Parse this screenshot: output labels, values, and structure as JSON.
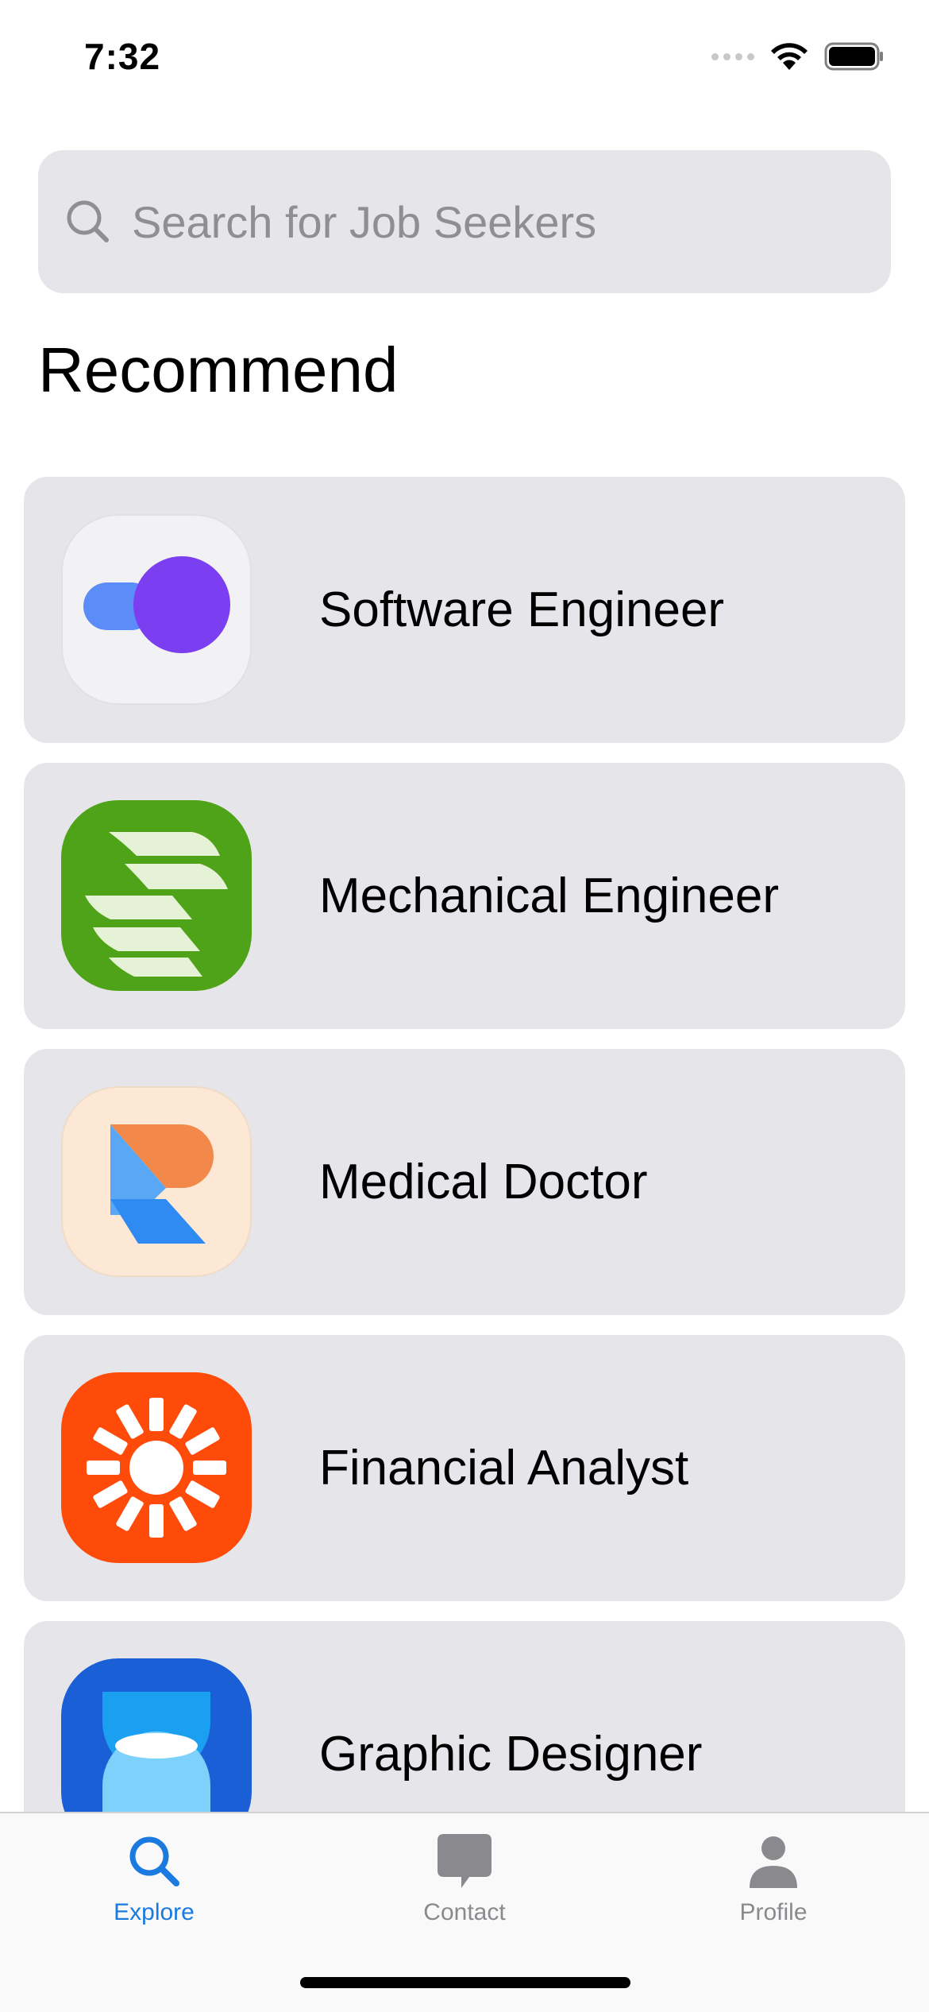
{
  "status_bar": {
    "time": "7:32"
  },
  "search": {
    "placeholder": "Search for Job Seekers",
    "value": ""
  },
  "section": {
    "title": "Recommend"
  },
  "jobs": [
    {
      "label": "Software Engineer",
      "icon": "overlapping-circles-icon"
    },
    {
      "label": "Mechanical Engineer",
      "icon": "striped-leaf-icon"
    },
    {
      "label": "Medical Doctor",
      "icon": "letter-r-shapes-icon"
    },
    {
      "label": "Financial Analyst",
      "icon": "sunburst-icon"
    },
    {
      "label": "Graphic Designer",
      "icon": "hourglass-icon"
    }
  ],
  "tabs": [
    {
      "label": "Explore",
      "icon": "search-icon",
      "active": true
    },
    {
      "label": "Contact",
      "icon": "chat-bubble-icon",
      "active": false
    },
    {
      "label": "Profile",
      "icon": "person-icon",
      "active": false
    }
  ],
  "colors": {
    "accent": "#1a7ae0",
    "card": "#e5e5ea",
    "inactive": "#8a8a8e"
  }
}
